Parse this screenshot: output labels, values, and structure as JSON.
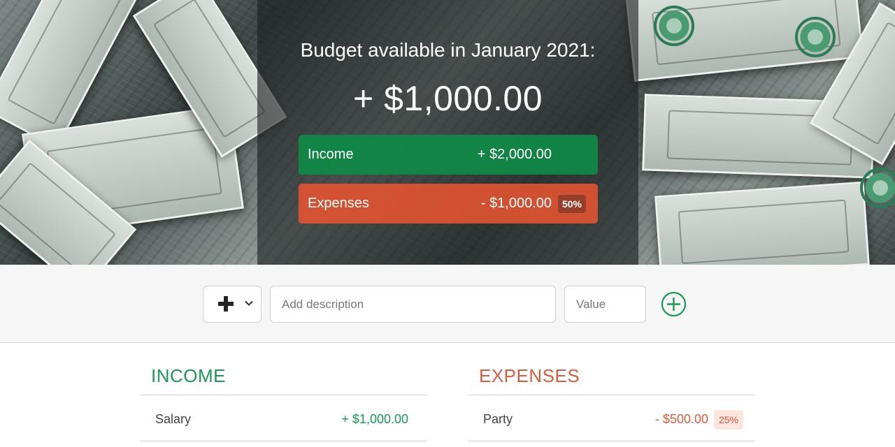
{
  "header": {
    "title": "Budget available in January 2021:",
    "total": "+ $1,000.00",
    "income": {
      "label": "Income",
      "value": "+ $2,000.00"
    },
    "expenses": {
      "label": "Expenses",
      "value": "- $1,000.00",
      "percentage": "50%"
    }
  },
  "add_form": {
    "type_icon": "plus-icon",
    "type_chevron": "chevron-down-icon",
    "description_placeholder": "Add description",
    "value_placeholder": "Value",
    "add_button_icon": "plus-circle-icon"
  },
  "income": {
    "title": "INCOME",
    "items": [
      {
        "description": "Salary",
        "value": "+ $1,000.00"
      }
    ]
  },
  "expenses": {
    "title": "EXPENSES",
    "items": [
      {
        "description": "Party",
        "value": "- $500.00",
        "percentage": "25%"
      }
    ]
  },
  "colors": {
    "income": "#189a55",
    "expense": "#df5a3d",
    "income_pill": "#0f8a46",
    "expense_pill": "#e25332"
  }
}
